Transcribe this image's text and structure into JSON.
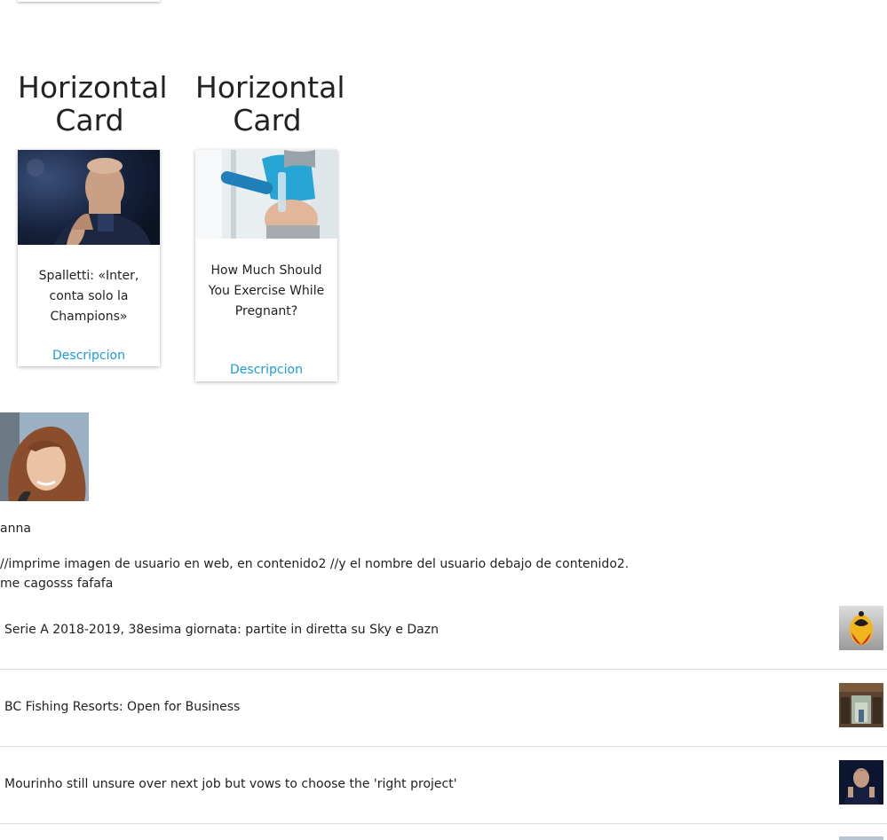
{
  "cards": [
    {
      "heading": "Horizontal Card",
      "title": "Spalletti: «Inter, conta solo la Champions»",
      "link_label": "Descripcion",
      "image": "coach-photo"
    },
    {
      "heading": "Horizontal Card",
      "title": "How Much Should You Exercise While Pregnant?",
      "link_label": "Descripcion",
      "image": "pregnant-exercise-photo"
    }
  ],
  "user": {
    "name": "anna",
    "content2_line1": "//imprime imagen de usuario en web, en contenido2 //y el nombre del usuario debajo de contenido2.",
    "content2_line2": "me cagosss fafafa"
  },
  "news": [
    {
      "title": "Serie A 2018-2019, 38esima giornata: partite in diretta su Sky e Dazn",
      "thumb": "soccer-ball-thumb"
    },
    {
      "title": "BC Fishing Resorts: Open for Business",
      "thumb": "resort-thumb"
    },
    {
      "title": "Mourinho still unsure over next job but vows to choose the 'right project'",
      "thumb": "mourinho-thumb"
    }
  ],
  "colors": {
    "link": "#1a9bd7",
    "divider": "#dcdcdc"
  }
}
